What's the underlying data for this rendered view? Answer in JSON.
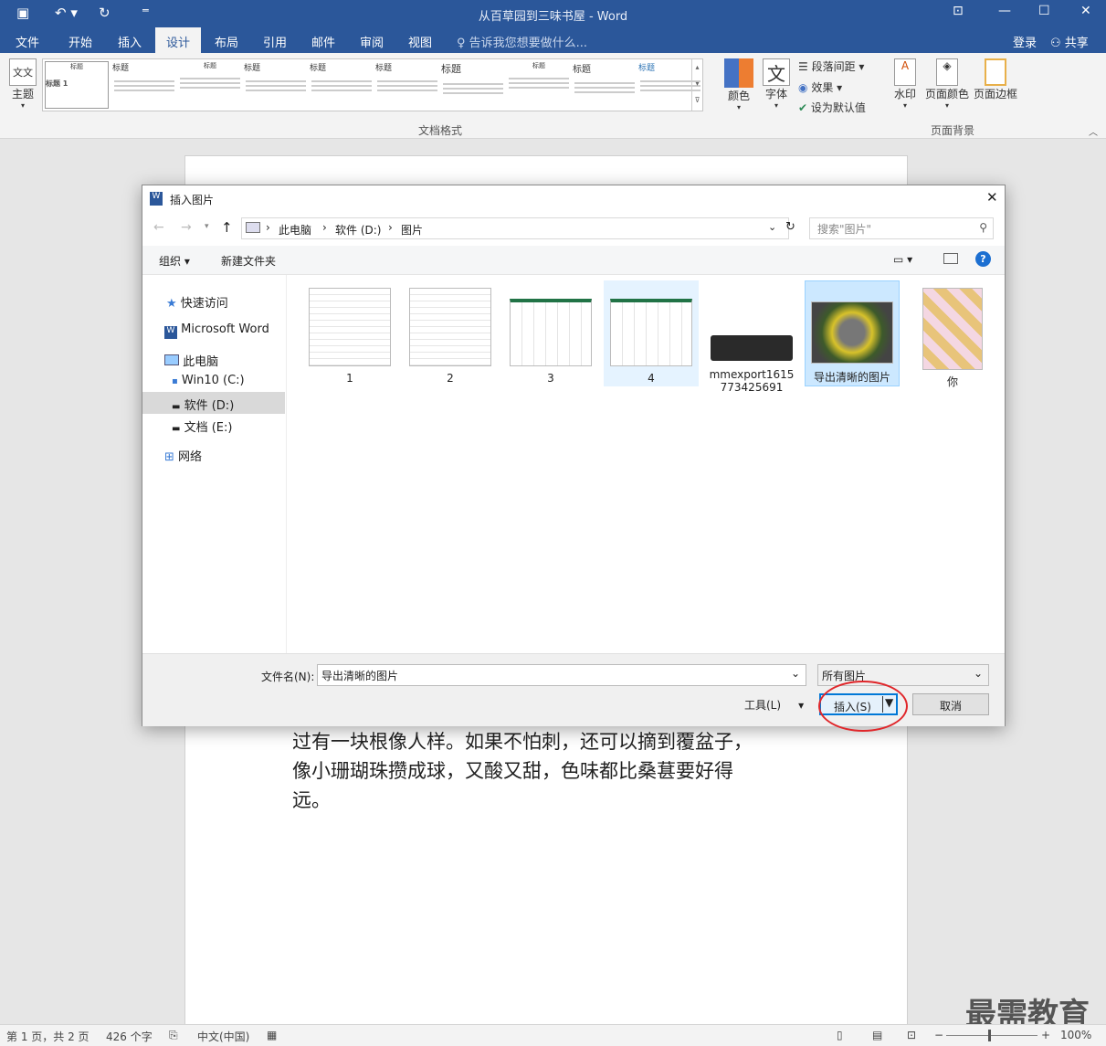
{
  "window": {
    "title": "从百草园到三味书屋 - Word",
    "login": "登录",
    "share": "共享"
  },
  "tabs": [
    "文件",
    "开始",
    "插入",
    "设计",
    "布局",
    "引用",
    "邮件",
    "审阅",
    "视图"
  ],
  "tell_me": "告诉我您想要做什么...",
  "ribbon": {
    "theme": "主题",
    "gallery_heading": "标题",
    "gallery_heading1": "标题 1",
    "group_doc_format": "文档格式",
    "colors": "颜色",
    "fonts": "字体",
    "paragraph_spacing": "段落间距",
    "effects": "效果",
    "set_default": "设为默认值",
    "watermark": "水印",
    "page_color": "页面颜色",
    "page_border": "页面边框",
    "group_page_bg": "页面背景"
  },
  "document": {
    "lines": [
      "过有一块根像人样。如果不怕刺，还可以摘到覆盆子，",
      "像小珊瑚珠攒成球，又酸又甜，色味都比桑葚要好得",
      "远。"
    ]
  },
  "status": {
    "page": "第 1 页，共 2 页",
    "words": "426 个字",
    "lang": "中文(中国)",
    "zoom": "100%"
  },
  "watermark_brand": "最需教育",
  "dialog": {
    "title": "插入图片",
    "breadcrumb": [
      "此电脑",
      "软件 (D:)",
      "图片"
    ],
    "search_placeholder": "搜索\"图片\"",
    "organize": "组织",
    "new_folder": "新建文件夹",
    "nav": {
      "quick": "快速访问",
      "word": "Microsoft Word",
      "pc": "此电脑",
      "c": "Win10 (C:)",
      "d": "软件 (D:)",
      "e": "文档 (E:)",
      "net": "网络"
    },
    "files": [
      "1",
      "2",
      "3",
      "4",
      "mmexport1615773425691",
      "导出清晰的图片",
      "你"
    ],
    "filename_label": "文件名(N):",
    "filename_value": "导出清晰的图片",
    "filetype": "所有图片",
    "tools": "工具(L)",
    "insert": "插入(S)",
    "cancel": "取消"
  }
}
